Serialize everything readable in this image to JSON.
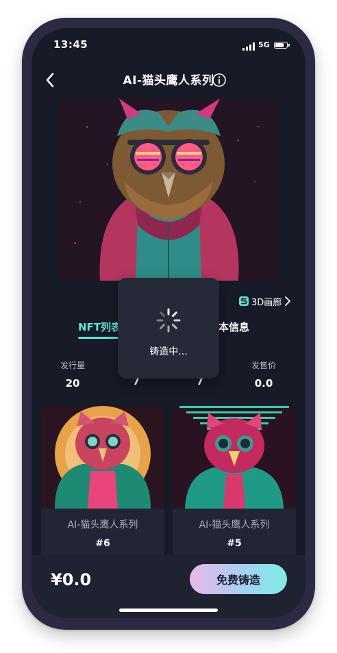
{
  "status_bar": {
    "time": "13:45",
    "network": "5G"
  },
  "header": {
    "title": "AI-猫头鹰人系列"
  },
  "gallery_link": {
    "label": "3D画廊"
  },
  "tabs": [
    {
      "label": "NFT列表"
    },
    {
      "label": "基本信息"
    }
  ],
  "stats": [
    {
      "label": "发行量",
      "value": "20"
    },
    {
      "label": "",
      "value": "7"
    },
    {
      "label": "",
      "value": "7"
    },
    {
      "label": "发售价",
      "value": "0.0"
    }
  ],
  "nft_cards": [
    {
      "name": "AI-猫头鹰人系列",
      "number": "#6"
    },
    {
      "name": "AI-猫头鹰人系列",
      "number": "#5"
    }
  ],
  "footer": {
    "price": "¥0.0",
    "mint_button": "免费铸造"
  },
  "loading_toast": {
    "text": "铸造中..."
  },
  "colors": {
    "accent": "#5fe3d5",
    "background": "#171a27",
    "phone_frame": "#2c2a43"
  }
}
